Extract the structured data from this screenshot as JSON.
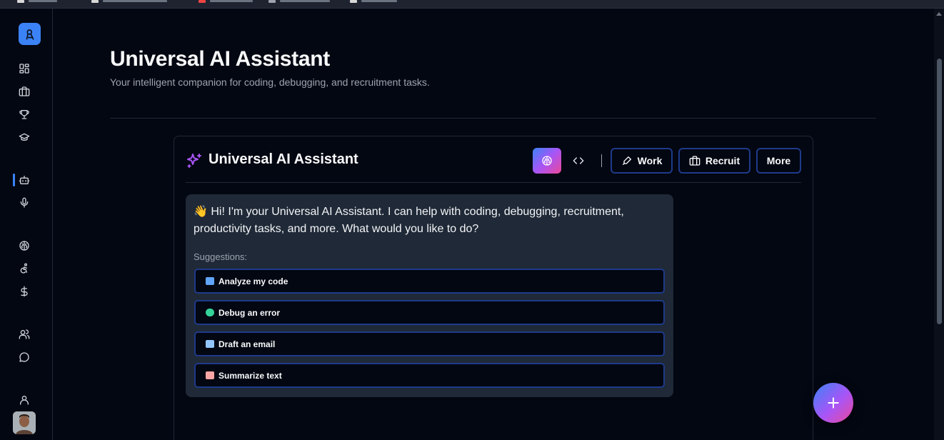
{
  "header": {
    "title": "Universal AI Assistant",
    "subtitle": "Your intelligent companion for coding, debugging, and recruitment tasks."
  },
  "sidebar": {
    "logo": "logo-icon",
    "items": [
      {
        "icon": "dashboard-icon"
      },
      {
        "icon": "briefcase-icon"
      },
      {
        "icon": "trophy-icon"
      },
      {
        "icon": "graduation-cap-icon"
      },
      {
        "icon": "bot-icon",
        "active": true
      },
      {
        "icon": "microphone-icon"
      },
      {
        "icon": "brain-icon"
      },
      {
        "icon": "accessibility-icon"
      },
      {
        "icon": "dollar-icon"
      },
      {
        "icon": "users-icon"
      },
      {
        "icon": "chat-icon"
      },
      {
        "icon": "user-icon"
      }
    ]
  },
  "assistant": {
    "title": "Universal AI Assistant",
    "title_icon": "sparkles-icon",
    "mode_buttons": [
      {
        "icon": "brain-icon",
        "active": true
      },
      {
        "icon": "code-icon"
      }
    ],
    "actions": {
      "work": "Work",
      "recruit": "Recruit",
      "more": "More"
    },
    "message": "👋 Hi! I'm your Universal AI Assistant. I can help with coding, debugging, recruitment, productivity tasks, and more. What would you like to do?",
    "suggestions_label": "Suggestions:",
    "suggestions": [
      {
        "label": "Analyze my code",
        "emoji": "laptop"
      },
      {
        "label": "Debug an error",
        "emoji": "bug"
      },
      {
        "label": "Draft an email",
        "emoji": "email"
      },
      {
        "label": "Summarize text",
        "emoji": "page"
      }
    ]
  },
  "fab": {
    "icon": "plus-icon"
  },
  "colors": {
    "background": "#030712",
    "accent": "#3b82f6",
    "gradient_start": "#3b82f6",
    "gradient_end": "#ec4899",
    "border_blue": "#1e3a8a",
    "bubble": "#1f2937"
  }
}
